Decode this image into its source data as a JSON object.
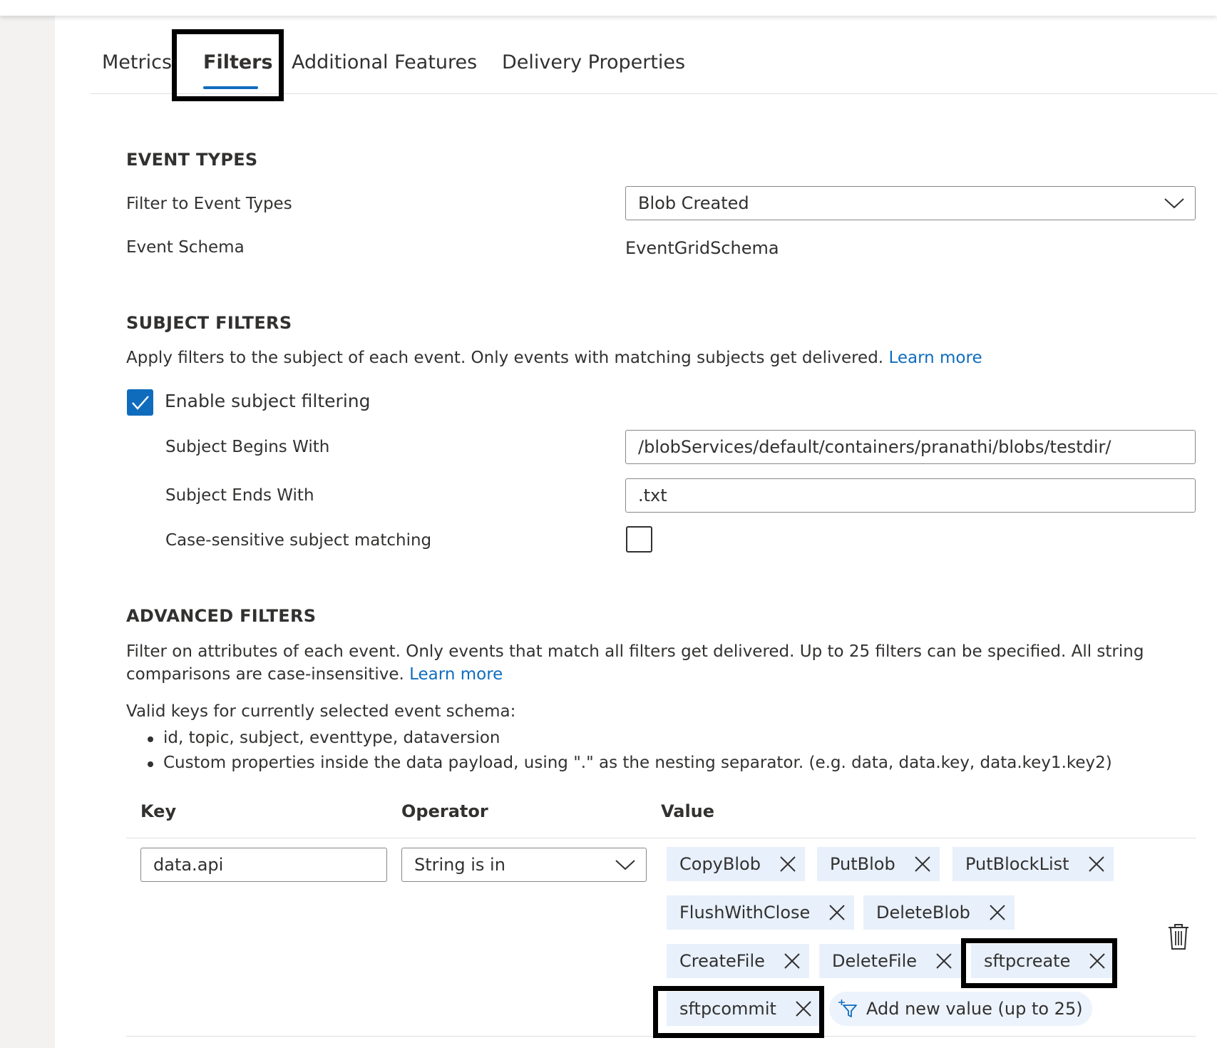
{
  "tabs": [
    {
      "label": "Metrics",
      "active": false
    },
    {
      "label": "Filters",
      "active": true
    },
    {
      "label": "Additional Features",
      "active": false
    },
    {
      "label": "Delivery Properties",
      "active": false
    }
  ],
  "event_types": {
    "title": "EVENT TYPES",
    "filter_label": "Filter to Event Types",
    "filter_value": "Blob Created",
    "schema_label": "Event Schema",
    "schema_value": "EventGridSchema"
  },
  "subject_filters": {
    "title": "SUBJECT FILTERS",
    "description": "Apply filters to the subject of each event. Only events with matching subjects get delivered.",
    "learn_more": "Learn more",
    "enable_label": "Enable subject filtering",
    "enable_checked": true,
    "begins_label": "Subject Begins With",
    "begins_value": "/blobServices/default/containers/pranathi/blobs/testdir/",
    "ends_label": "Subject Ends With",
    "ends_value": ".txt",
    "case_label": "Case-sensitive subject matching",
    "case_checked": false
  },
  "advanced_filters": {
    "title": "ADVANCED FILTERS",
    "description": "Filter on attributes of each event. Only events that match all filters get delivered. Up to 25 filters can be specified. All string comparisons are case-insensitive.",
    "learn_more": "Learn more",
    "valid_keys_intro": "Valid keys for currently selected event schema:",
    "bullets": [
      "id, topic, subject, eventtype, dataversion",
      "Custom properties inside the data payload, using \".\" as the nesting separator. (e.g. data, data.key, data.key1.key2)"
    ],
    "columns": {
      "key": "Key",
      "operator": "Operator",
      "value": "Value"
    },
    "row": {
      "key": "data.api",
      "operator": "String is in",
      "values": [
        "CopyBlob",
        "PutBlob",
        "PutBlockList",
        "FlushWithClose",
        "DeleteBlob",
        "CreateFile",
        "DeleteFile",
        "sftpcreate",
        "sftpcommit"
      ],
      "add_value": "Add new value (up to 25)"
    }
  },
  "colors": {
    "accent": "#0f6cbd",
    "chip_bg": "#e8f0fb",
    "text": "#323130",
    "border": "#8a8886"
  },
  "icons": [
    "chevron-down-icon",
    "checkmark-icon",
    "dismiss-icon",
    "add-filter-icon",
    "trash-icon"
  ]
}
